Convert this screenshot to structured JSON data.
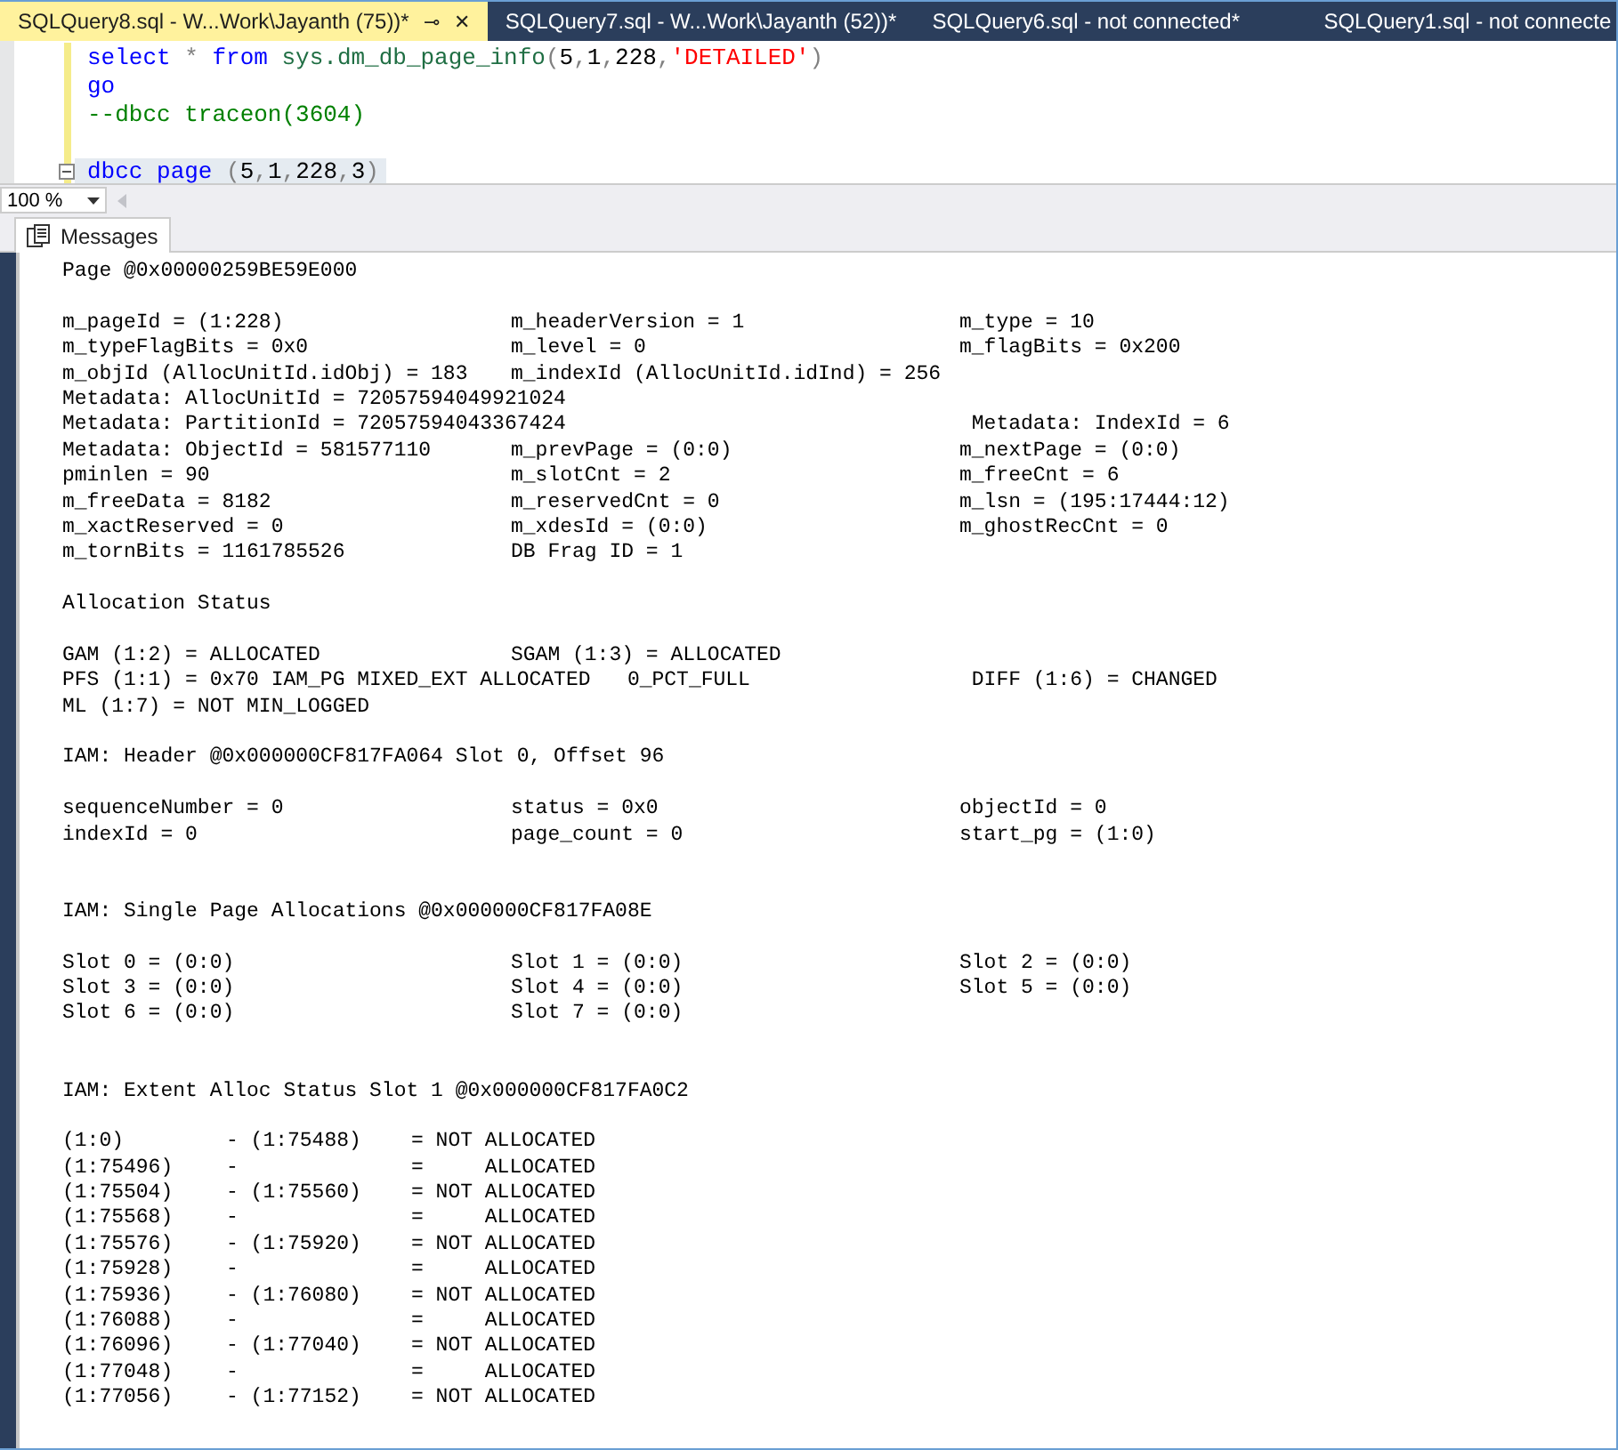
{
  "tabs": [
    {
      "label": "SQLQuery8.sql - W...Work\\Jayanth (75))*",
      "selected": true,
      "pin": "⊸",
      "close": "✕"
    },
    {
      "label": "SQLQuery7.sql - W...Work\\Jayanth (52))*",
      "selected": false
    },
    {
      "label": "SQLQuery6.sql - not connected*",
      "selected": false
    },
    {
      "label": "SQLQuery1.sql - not connecte",
      "selected": false
    }
  ],
  "editor": {
    "lines": [
      {
        "tokens": [
          {
            "kind": "keyword",
            "text": "select"
          },
          {
            "kind": "operator",
            "text": " * "
          },
          {
            "kind": "keyword",
            "text": "from"
          },
          {
            "kind": "system",
            "text": " sys.dm_db_page_info"
          },
          {
            "kind": "operator",
            "text": "("
          },
          {
            "kind": "plain",
            "text": "5"
          },
          {
            "kind": "operator",
            "text": ","
          },
          {
            "kind": "plain",
            "text": "1"
          },
          {
            "kind": "operator",
            "text": ","
          },
          {
            "kind": "plain",
            "text": "228"
          },
          {
            "kind": "operator",
            "text": ","
          },
          {
            "kind": "string",
            "text": "'DETAILED'"
          },
          {
            "kind": "operator",
            "text": ")"
          }
        ]
      },
      {
        "tokens": [
          {
            "kind": "keyword",
            "text": "go"
          }
        ]
      },
      {
        "tokens": [
          {
            "kind": "comment",
            "text": "--dbcc traceon(3604)"
          }
        ]
      },
      {
        "kind": "blank"
      },
      {
        "collapsible": true,
        "highlighted": true,
        "tokens": [
          {
            "kind": "keyword",
            "text": "dbcc"
          },
          {
            "kind": "keyword",
            "text": " page"
          },
          {
            "kind": "operator",
            "text": " ("
          },
          {
            "kind": "plain",
            "text": "5"
          },
          {
            "kind": "operator",
            "text": ","
          },
          {
            "kind": "plain",
            "text": "1"
          },
          {
            "kind": "operator",
            "text": ","
          },
          {
            "kind": "plain",
            "text": "228"
          },
          {
            "kind": "operator",
            "text": ","
          },
          {
            "kind": "plain",
            "text": "3"
          },
          {
            "kind": "operator",
            "text": ")"
          }
        ]
      }
    ]
  },
  "zoom": {
    "value": "100 %"
  },
  "results_tabs": [
    {
      "label": "Messages",
      "selected": true
    }
  ],
  "messages": [
    {
      "kind": "text",
      "text": "Page @0x00000259BE59E000"
    },
    {
      "kind": "blank"
    },
    {
      "kind": "row",
      "cells": [
        "m_pageId = (1:228)",
        "m_headerVersion = 1",
        "m_type = 10"
      ]
    },
    {
      "kind": "row",
      "cells": [
        "m_typeFlagBits = 0x0",
        "m_level = 0",
        "m_flagBits = 0x200"
      ]
    },
    {
      "kind": "row",
      "cells": [
        "m_objId (AllocUnitId.idObj) = 183",
        "m_indexId (AllocUnitId.idInd) = 256"
      ]
    },
    {
      "kind": "text",
      "text": "Metadata: AllocUnitId = 72057594049921024"
    },
    {
      "kind": "span",
      "text": "Metadata: PartitionId = 72057594043367424",
      "last": " Metadata: IndexId = 6"
    },
    {
      "kind": "row",
      "cells": [
        "Metadata: ObjectId = 581577110",
        "m_prevPage = (0:0)",
        "m_nextPage = (0:0)"
      ]
    },
    {
      "kind": "row",
      "cells": [
        "pminlen = 90",
        "m_slotCnt = 2",
        "m_freeCnt = 6"
      ]
    },
    {
      "kind": "row",
      "cells": [
        "m_freeData = 8182",
        "m_reservedCnt = 0",
        "m_lsn = (195:17444:12)"
      ]
    },
    {
      "kind": "row",
      "cells": [
        "m_xactReserved = 0",
        "m_xdesId = (0:0)",
        "m_ghostRecCnt = 0"
      ]
    },
    {
      "kind": "row",
      "cells": [
        "m_tornBits = 1161785526",
        "DB Frag ID = 1"
      ]
    },
    {
      "kind": "blank"
    },
    {
      "kind": "text",
      "text": "Allocation Status"
    },
    {
      "kind": "blank"
    },
    {
      "kind": "row",
      "cells": [
        "GAM (1:2) = ALLOCATED",
        "SGAM (1:3) = ALLOCATED"
      ]
    },
    {
      "kind": "span",
      "text": "PFS (1:1) = 0x70 IAM_PG MIXED_EXT ALLOCATED   0_PCT_FULL",
      "last": " DIFF (1:6) = CHANGED"
    },
    {
      "kind": "text",
      "text": "ML (1:7) = NOT MIN_LOGGED"
    },
    {
      "kind": "blank"
    },
    {
      "kind": "text",
      "text": "IAM: Header @0x000000CF817FA064 Slot 0, Offset 96"
    },
    {
      "kind": "blank"
    },
    {
      "kind": "row",
      "cells": [
        "sequenceNumber = 0",
        "status = 0x0",
        "objectId = 0"
      ]
    },
    {
      "kind": "row",
      "cells": [
        "indexId = 0",
        "page_count = 0",
        "start_pg = (1:0)"
      ]
    },
    {
      "kind": "blank"
    },
    {
      "kind": "blank"
    },
    {
      "kind": "text",
      "text": "IAM: Single Page Allocations @0x000000CF817FA08E"
    },
    {
      "kind": "blank"
    },
    {
      "kind": "row",
      "cells": [
        "Slot 0 = (0:0)",
        "Slot 1 = (0:0)",
        "Slot 2 = (0:0)"
      ]
    },
    {
      "kind": "row",
      "cells": [
        "Slot 3 = (0:0)",
        "Slot 4 = (0:0)",
        "Slot 5 = (0:0)"
      ]
    },
    {
      "kind": "row",
      "cells": [
        "Slot 6 = (0:0)",
        "Slot 7 = (0:0)"
      ]
    },
    {
      "kind": "blank"
    },
    {
      "kind": "blank"
    },
    {
      "kind": "text",
      "text": "IAM: Extent Alloc Status Slot 1 @0x000000CF817FA0C2"
    },
    {
      "kind": "blank"
    },
    {
      "kind": "extent",
      "from": "(1:0)",
      "to": "- (1:75488)",
      "status": "= NOT ALLOCATED"
    },
    {
      "kind": "extent",
      "from": "(1:75496)",
      "to": "-",
      "status": "=     ALLOCATED"
    },
    {
      "kind": "extent",
      "from": "(1:75504)",
      "to": "- (1:75560)",
      "status": "= NOT ALLOCATED"
    },
    {
      "kind": "extent",
      "from": "(1:75568)",
      "to": "-",
      "status": "=     ALLOCATED"
    },
    {
      "kind": "extent",
      "from": "(1:75576)",
      "to": "- (1:75920)",
      "status": "= NOT ALLOCATED"
    },
    {
      "kind": "extent",
      "from": "(1:75928)",
      "to": "-",
      "status": "=     ALLOCATED"
    },
    {
      "kind": "extent",
      "from": "(1:75936)",
      "to": "- (1:76080)",
      "status": "= NOT ALLOCATED"
    },
    {
      "kind": "extent",
      "from": "(1:76088)",
      "to": "-",
      "status": "=     ALLOCATED"
    },
    {
      "kind": "extent",
      "from": "(1:76096)",
      "to": "- (1:77040)",
      "status": "= NOT ALLOCATED"
    },
    {
      "kind": "extent",
      "from": "(1:77048)",
      "to": "-",
      "status": "=     ALLOCATED"
    },
    {
      "kind": "extent",
      "from": "(1:77056)",
      "to": "- (1:77152)",
      "status": "= NOT ALLOCATED"
    }
  ]
}
